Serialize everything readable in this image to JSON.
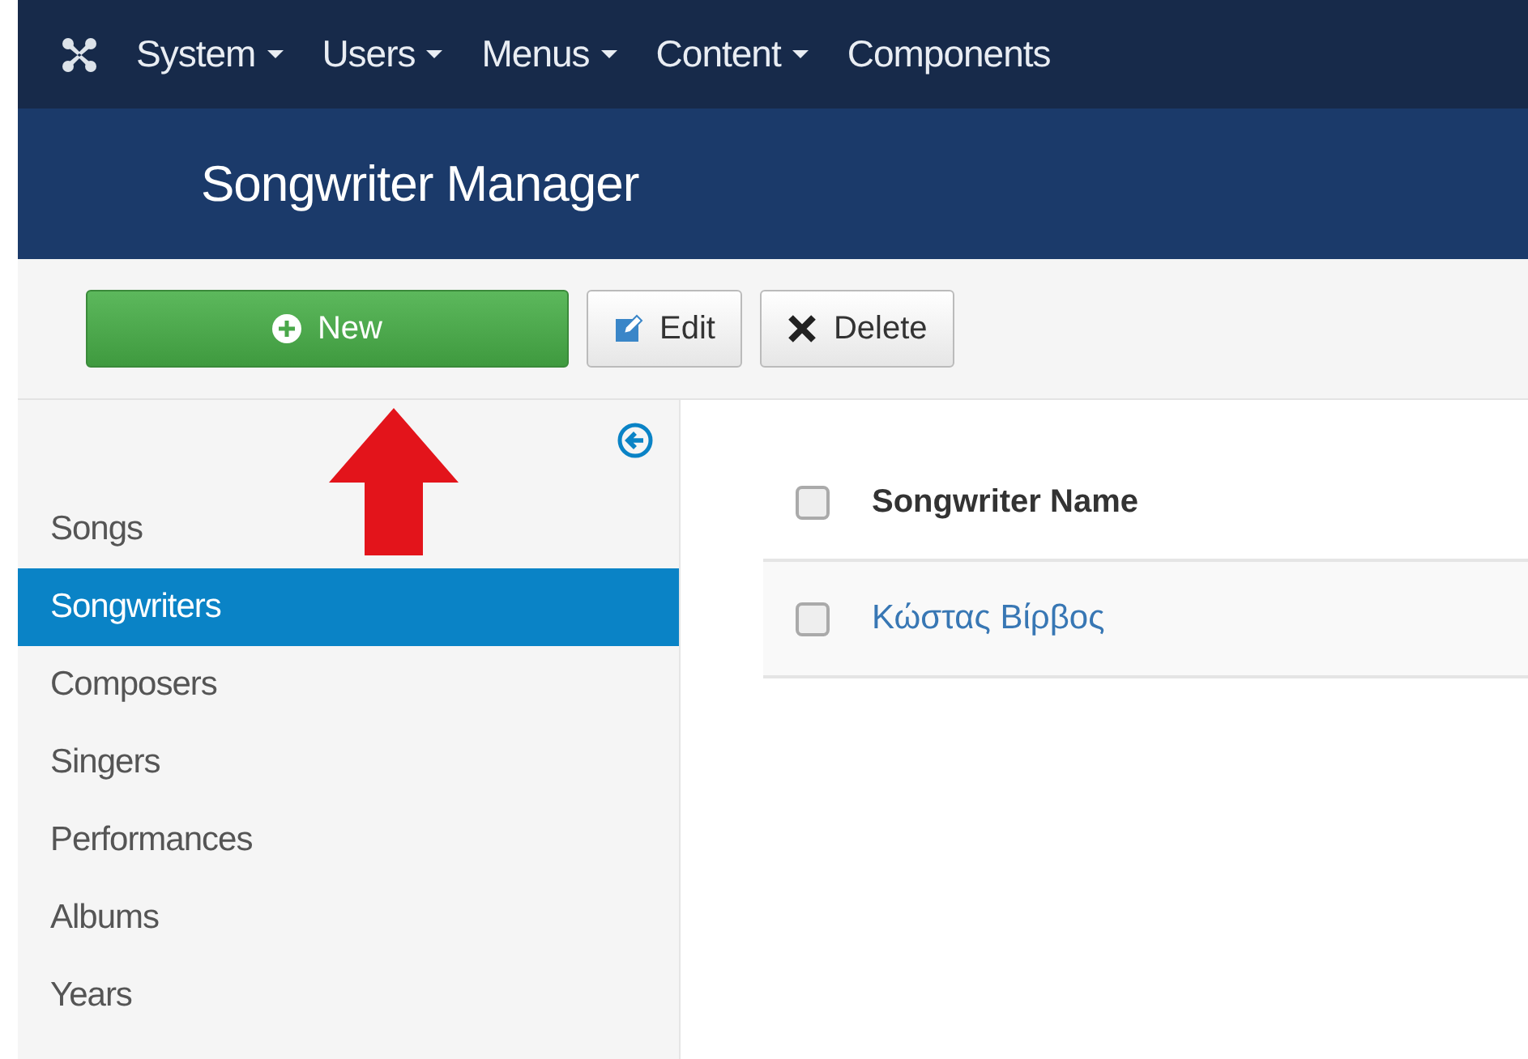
{
  "top_menu": [
    {
      "label": "System",
      "dropdown": true
    },
    {
      "label": "Users",
      "dropdown": true
    },
    {
      "label": "Menus",
      "dropdown": true
    },
    {
      "label": "Content",
      "dropdown": true
    },
    {
      "label": "Components",
      "dropdown": false
    }
  ],
  "header": {
    "title": "Songwriter Manager"
  },
  "toolbar": [
    {
      "label": "New",
      "kind": "new"
    },
    {
      "label": "Edit",
      "kind": "edit"
    },
    {
      "label": "Delete",
      "kind": "delete"
    }
  ],
  "sidebar": {
    "items": [
      {
        "label": "Songs",
        "selected": false
      },
      {
        "label": "Songwriters",
        "selected": true
      },
      {
        "label": "Composers",
        "selected": false
      },
      {
        "label": "Singers",
        "selected": false
      },
      {
        "label": "Performances",
        "selected": false
      },
      {
        "label": "Albums",
        "selected": false
      },
      {
        "label": "Years",
        "selected": false
      }
    ]
  },
  "table": {
    "header": {
      "label": "Songwriter Name",
      "checked": false
    },
    "rows": [
      {
        "name": "Κώστας Βίρβος",
        "checked": false
      }
    ]
  }
}
